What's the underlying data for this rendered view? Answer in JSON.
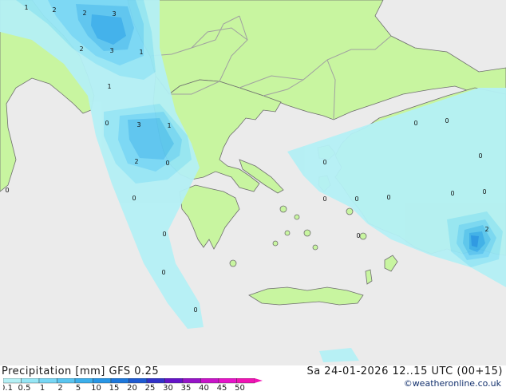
{
  "header": {
    "title": "Precipitation [mm]  GFS 0.25",
    "valid": "Sa 24-01-2026 12..15 UTC (00+15)",
    "credit": "©weatheronline.co.uk"
  },
  "legend": {
    "labels": [
      "0.1",
      "0.5",
      "1",
      "2",
      "5",
      "10",
      "15",
      "20",
      "25",
      "30",
      "35",
      "40",
      "45",
      "50"
    ],
    "colors": [
      "#b4f0f5",
      "#96e6f5",
      "#78d7f5",
      "#5ac5f0",
      "#3cafeb",
      "#2896e6",
      "#1e78dc",
      "#1e5ad2",
      "#3232c8",
      "#6414c8",
      "#9614c8",
      "#c814c8",
      "#e614c8",
      "#f014b4"
    ]
  },
  "colors": {
    "sea": "#ebebeb",
    "land": "#c8f5a0",
    "border": "#a0a0a0",
    "coast": "#6e6e6e"
  },
  "map_labels": [
    {
      "text": "1"
    },
    {
      "text": "2"
    },
    {
      "text": "2"
    },
    {
      "text": "3"
    },
    {
      "text": "2"
    },
    {
      "text": "3"
    },
    {
      "text": "1"
    },
    {
      "text": "1"
    },
    {
      "text": "0"
    },
    {
      "text": "3"
    },
    {
      "text": "1"
    },
    {
      "text": "2"
    },
    {
      "text": "0"
    },
    {
      "text": "0"
    },
    {
      "text": "0"
    },
    {
      "text": "0"
    },
    {
      "text": "0"
    },
    {
      "text": "0"
    },
    {
      "text": "0"
    },
    {
      "text": "0"
    },
    {
      "text": "0"
    },
    {
      "text": "0"
    },
    {
      "text": "0"
    },
    {
      "text": "0"
    },
    {
      "text": "0"
    },
    {
      "text": "0"
    },
    {
      "text": "0"
    },
    {
      "text": "2"
    },
    {
      "text": "0"
    }
  ]
}
